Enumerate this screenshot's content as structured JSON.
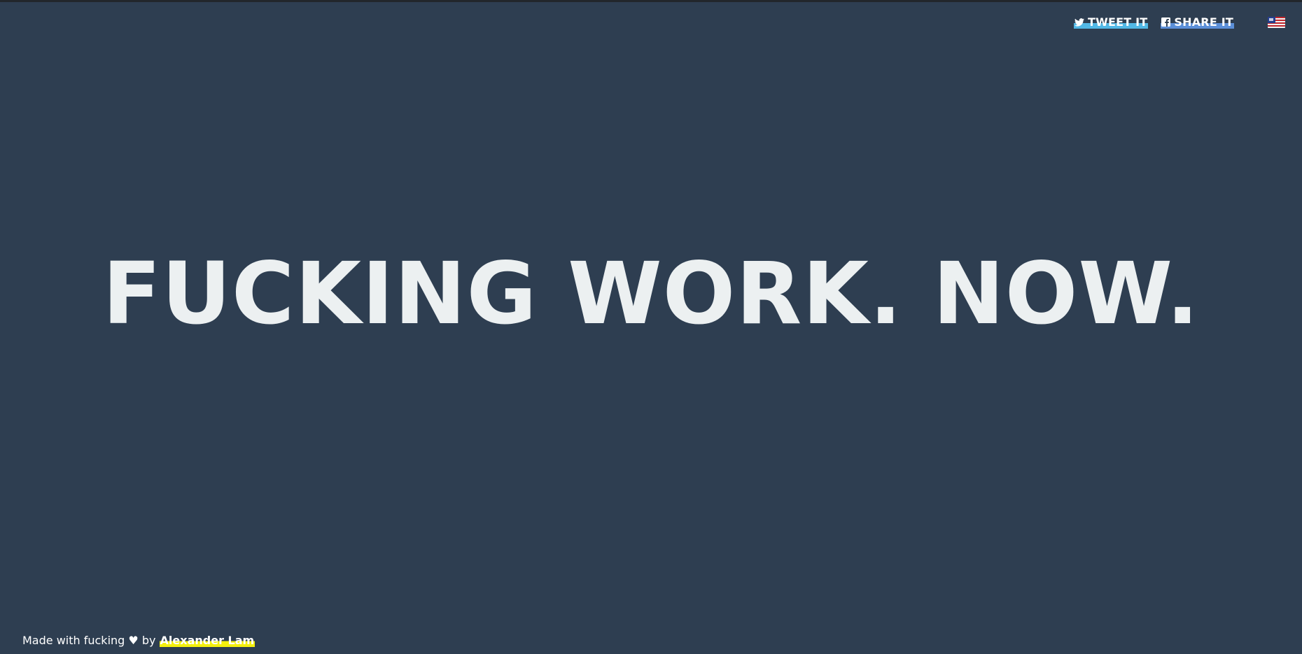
{
  "colors": {
    "background": "#2e3e51",
    "headline": "#ecf0f1",
    "tweet_underline": "#52b8e6",
    "share_underline": "#5b8fd8",
    "author_highlight": "#f4f00d"
  },
  "topbar": {
    "tweet": {
      "label": "TWEET IT",
      "icon": "twitter-icon"
    },
    "share": {
      "label": "SHARE IT",
      "icon": "facebook-icon"
    },
    "language": {
      "icon": "us-flag-icon"
    }
  },
  "main": {
    "headline": "FUCKING WORK. NOW."
  },
  "footer": {
    "prefix": "Made with fucking ♥ by ",
    "author": "Alexander Lam"
  }
}
